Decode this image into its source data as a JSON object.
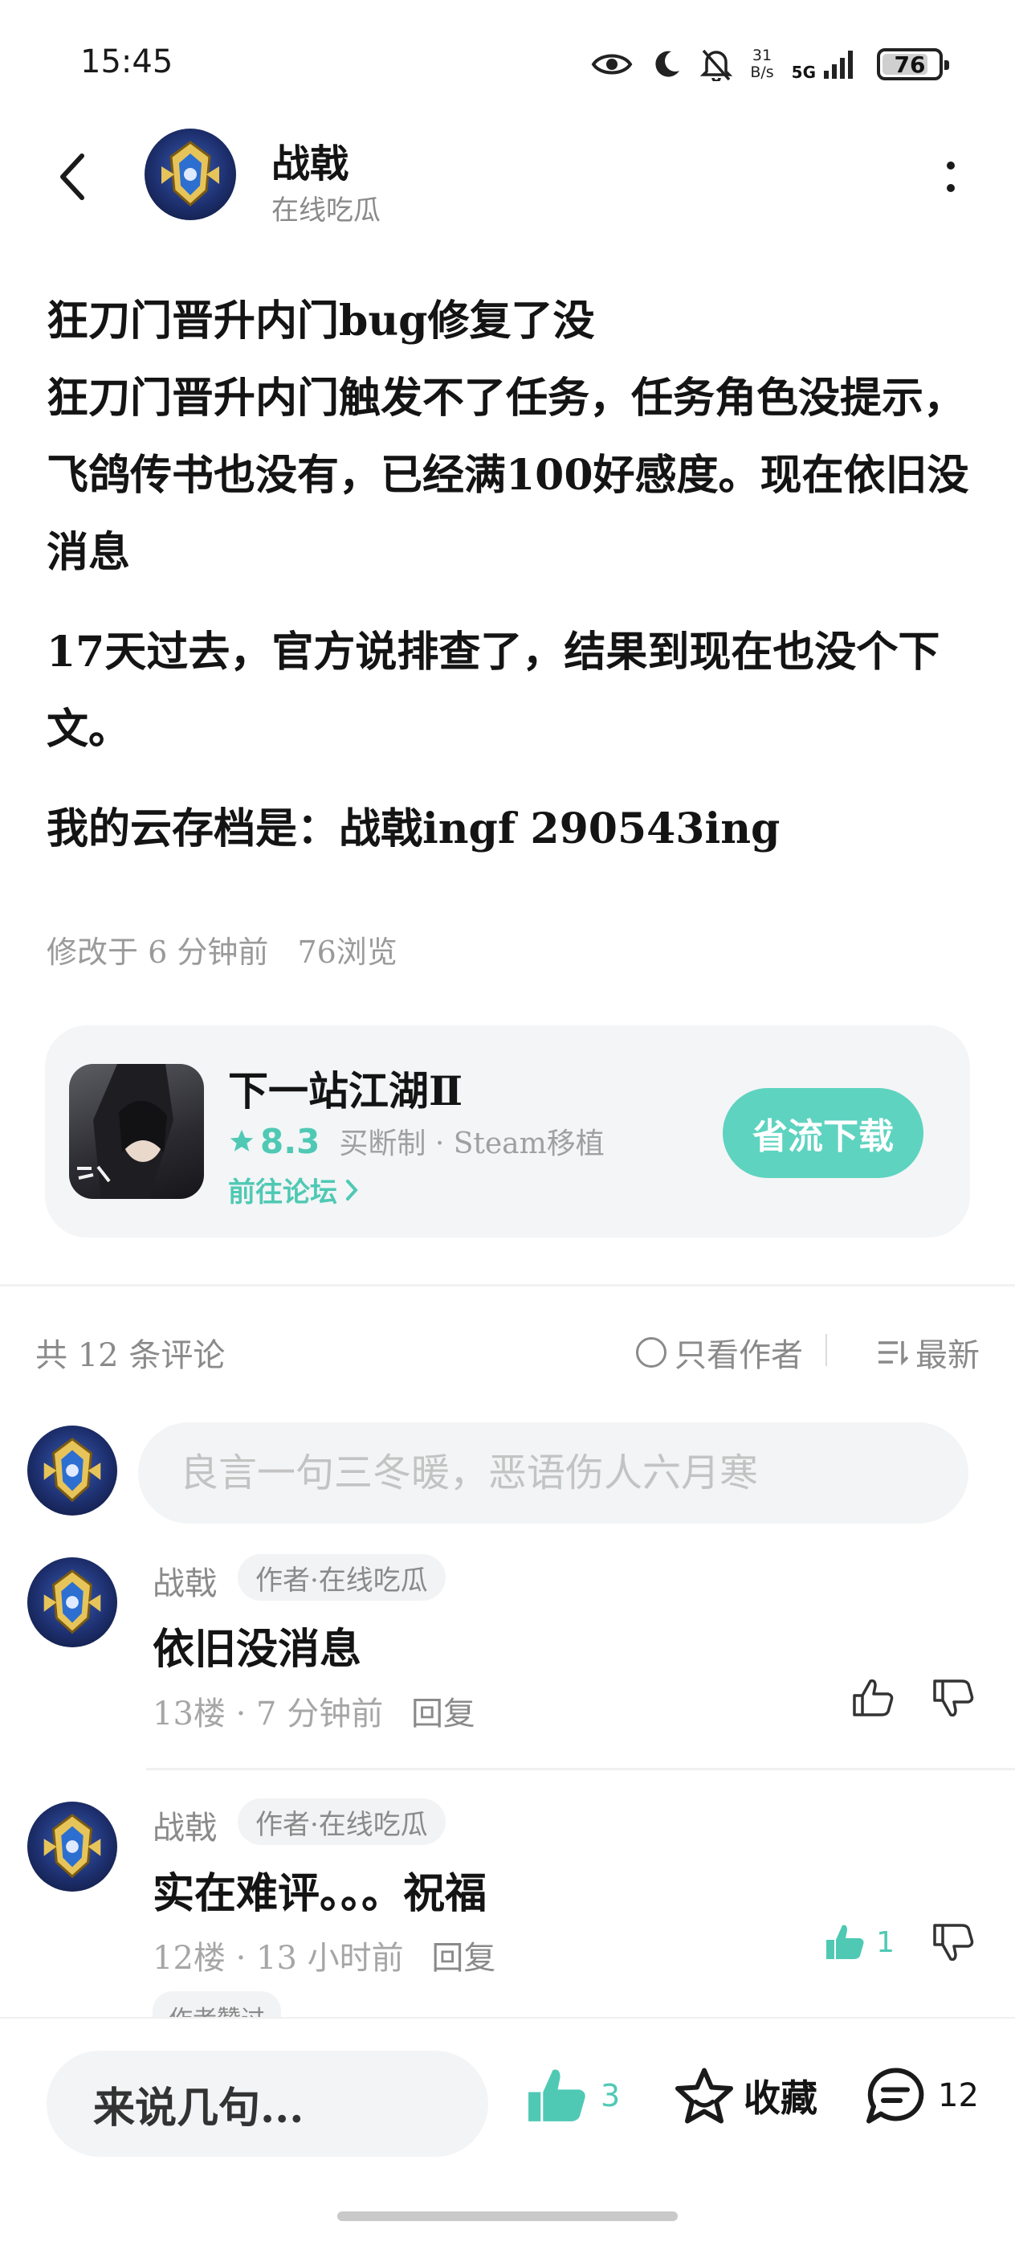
{
  "status_bar": {
    "time": "15:45",
    "net_speed_value": "31",
    "net_speed_unit": "B/s",
    "network": "5G",
    "battery": "76",
    "icons": [
      "eye-icon",
      "moon-icon",
      "bell-off-icon",
      "signal-icon",
      "battery-icon"
    ]
  },
  "header": {
    "author_name": "战戟",
    "author_status": "在线吃瓜",
    "icons": [
      "back-arrow-icon",
      "more-vertical-icon"
    ]
  },
  "post": {
    "title": "狂刀门晋升内门bug修复了没",
    "paragraphs": [
      "狂刀门晋升内门触发不了任务，任务角色没提示，飞鸽传书也没有，已经满100好感度。现在依旧没消息",
      "17天过去，官方说排查了，结果到现在也没个下文。",
      "我的云存档是：战戟ingf  290543ing"
    ],
    "modified": "修改于 6 分钟前",
    "views": "76浏览"
  },
  "game_card": {
    "name": "下一站江湖Ⅱ",
    "rating": "8.3",
    "tags": "买断制 · Steam移植",
    "forum_link": "前往论坛",
    "download_button": "省流下载",
    "accent": "#5ed3c0"
  },
  "comments_section": {
    "count_label": "共 12 条评论",
    "only_author": "只看作者",
    "sort": "最新",
    "input_placeholder": "良言一句三冬暖，恶语伤人六月寒",
    "items": [
      {
        "name": "战戟",
        "badge": "作者·在线吃瓜",
        "text": "依旧没消息",
        "floor": "13楼 · 7 分钟前",
        "reply": "回复",
        "likes": ""
      },
      {
        "name": "战戟",
        "badge": "作者·在线吃瓜",
        "text": "实在难评。。。祝福",
        "floor": "12楼 · 13 小时前",
        "reply": "回复",
        "likes": "1"
      }
    ],
    "author_liked": "作者赞过"
  },
  "bottom_bar": {
    "input_label": "来说几句...",
    "likes": "3",
    "favorite": "收藏",
    "comments": "12"
  }
}
